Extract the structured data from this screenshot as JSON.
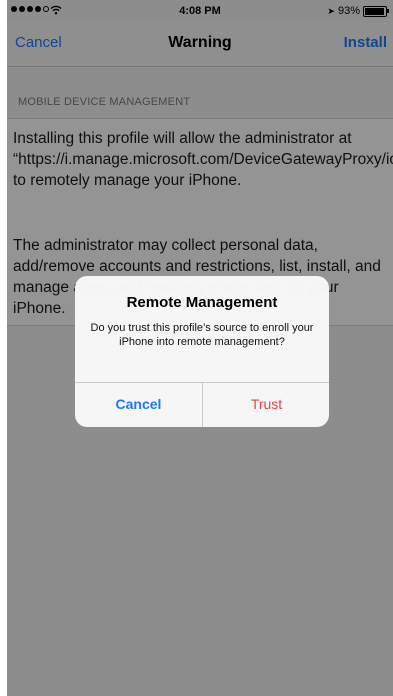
{
  "status_bar": {
    "time": "4:08 PM",
    "battery_percent": "93%",
    "icons": [
      "signal-dots-icon",
      "wifi-icon",
      "location-icon",
      "battery-icon"
    ]
  },
  "nav": {
    "cancel_label": "Cancel",
    "title": "Warning",
    "install_label": "Install"
  },
  "section": {
    "header": "MOBILE DEVICE MANAGEMENT",
    "paragraph1": "Installing this profile will allow the administrator at “https://i.manage.microsoft.com/DeviceGatewayProxy/ioshandler.ashx” to remotely manage your iPhone.",
    "paragraph2": "The administrator may collect personal data, add/remove accounts and restrictions, list, install, and manage apps, and remotely erase data on your iPhone."
  },
  "alert": {
    "title": "Remote Management",
    "message": "Do you trust this profile’s source to enroll your iPhone into remote management?",
    "cancel_label": "Cancel",
    "trust_label": "Trust"
  },
  "colors": {
    "accent": "#1a7cf5",
    "destructive": "#e5434c",
    "overlay": "#000000"
  }
}
